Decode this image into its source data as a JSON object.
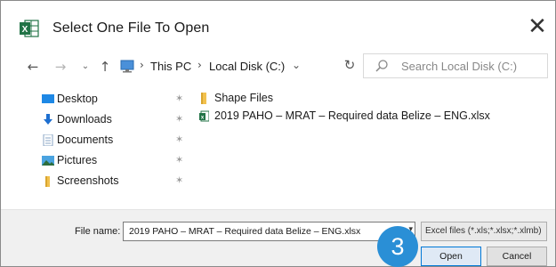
{
  "window": {
    "title": "Select One File To Open",
    "app_icon": "excel-icon",
    "close_glyph": "✕",
    "accent_color": "#217346"
  },
  "nav": {
    "back_glyph": "←",
    "forward_glyph": "→",
    "recent_glyph": "⌄",
    "up_glyph": "↑",
    "breadcrumb": [
      "This PC",
      "Local Disk (C:)"
    ],
    "breadcrumb_sep": "›",
    "dropdown_glyph": "⌄",
    "refresh_glyph": "↻",
    "search_placeholder": "Search Local Disk (C:)"
  },
  "sidebar": {
    "items": [
      {
        "label": "Desktop",
        "icon": "desktop-icon",
        "pinned": true
      },
      {
        "label": "Downloads",
        "icon": "downloads-icon",
        "pinned": true
      },
      {
        "label": "Documents",
        "icon": "documents-icon",
        "pinned": true
      },
      {
        "label": "Pictures",
        "icon": "pictures-icon",
        "pinned": true
      },
      {
        "label": "Screenshots",
        "icon": "folder-icon",
        "pinned": true
      }
    ],
    "pin_glyph": "✶"
  },
  "files": [
    {
      "name": "Shape Files",
      "type": "folder",
      "icon": "folder-icon"
    },
    {
      "name": "2019 PAHO – MRAT – Required data Belize – ENG.xlsx",
      "type": "excel",
      "icon": "excel-file-icon"
    }
  ],
  "footer": {
    "filename_label": "File name:",
    "filename_value": "2019 PAHO – MRAT – Required data Belize – ENG.xlsx",
    "filename_dropdown_glyph": "▾",
    "filetype": "Excel files (*.xls;*.xlsx;*.xlmb)",
    "open_label": "Open",
    "cancel_label": "Cancel"
  },
  "annotation": {
    "step_number": "3",
    "color": "#2a8fd6"
  }
}
